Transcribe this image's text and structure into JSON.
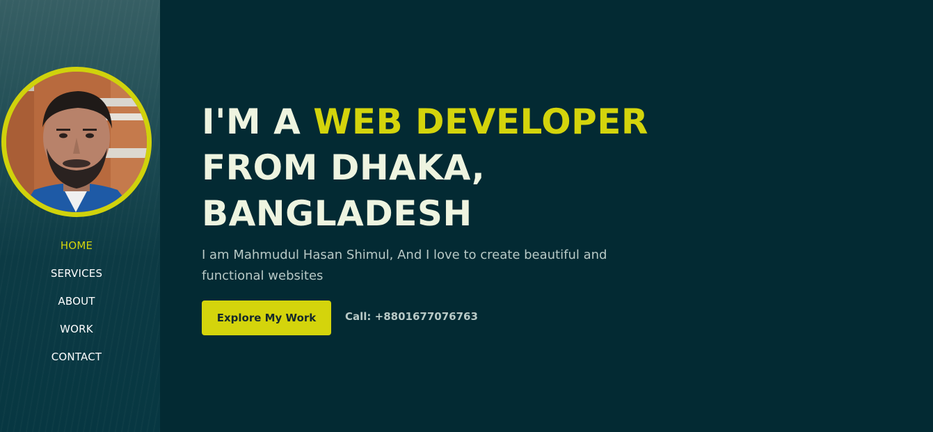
{
  "sidebar": {
    "avatar_alt": "Profile photo",
    "nav": [
      {
        "label": "HOME",
        "active": true
      },
      {
        "label": "SERVICES",
        "active": false
      },
      {
        "label": "ABOUT",
        "active": false
      },
      {
        "label": "WORK",
        "active": false
      },
      {
        "label": "CONTACT",
        "active": false
      }
    ]
  },
  "hero": {
    "headline_prefix": "I'M A ",
    "headline_accent": "WEB DEVELOPER",
    "headline_line2": "FROM DHAKA,",
    "headline_line3": "BANGLADESH",
    "subtitle": "I am Mahmudul Hasan Shimul, And I love to create beautiful and functional websites",
    "cta_label": "Explore My Work",
    "call_text": "Call: +8801677076763"
  },
  "colors": {
    "background": "#032a33",
    "accent": "#d4d40c",
    "headline": "#eef4e0",
    "body_text": "#b8c9c6"
  }
}
